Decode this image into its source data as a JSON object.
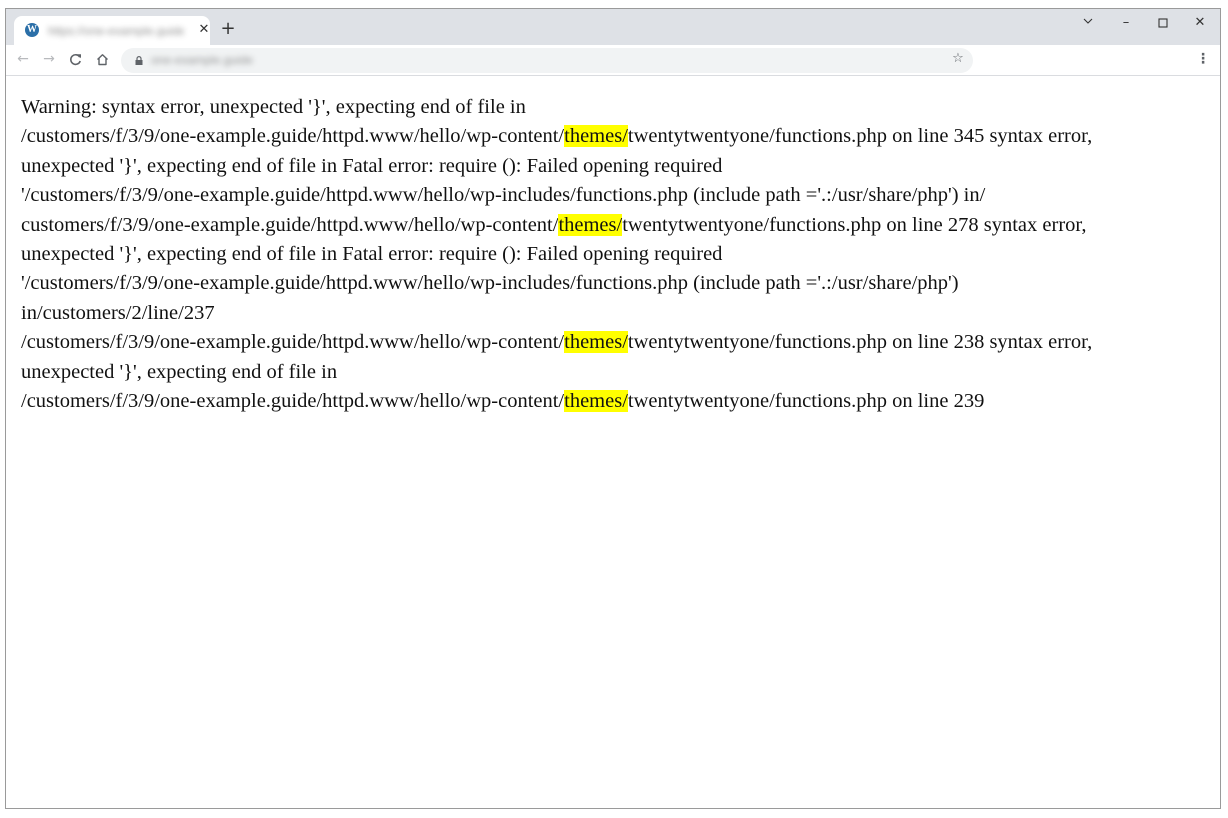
{
  "browser": {
    "tab": {
      "favicon": "wordpress-icon",
      "favicon_glyph": "W",
      "title": "https://one-example.guide",
      "close_glyph": "✕"
    },
    "new_tab_glyph": "+",
    "window_controls": {
      "dropdown_glyph": "⌄",
      "minimize_glyph": "–",
      "close_glyph": "✕"
    },
    "toolbar": {
      "back_glyph": "←",
      "forward_glyph": "→",
      "reload_glyph": "C",
      "url": "one-example.guide",
      "star_glyph": "☆",
      "menu_glyph": "⋮"
    }
  },
  "page": {
    "highlight_color": "#ffff00",
    "lines": [
      {
        "before": "Warning: syntax error, unexpected '}', expecting end of file in"
      },
      {
        "before": "/customers/f/3/9/one-example.guide/httpd.www/hello/wp-content/",
        "highlight": "themes/",
        "after": "twentytwentyone/functions.php on line 345 syntax error,"
      },
      {
        "before": "unexpected '}', expecting end of file in Fatal error: require (): Failed opening required"
      },
      {
        "before": "'/customers/f/3/9/one-example.guide/httpd.www/hello/wp-includes/functions.php (include path ='.:/usr/share/php') in/"
      },
      {
        "before": "customers/f/3/9/one-example.guide/httpd.www/hello/wp-content/",
        "highlight": "themes/",
        "after": "twentytwentyone/functions.php on line 278 syntax error,"
      },
      {
        "before": "unexpected '}', expecting end of file in Fatal error: require (): Failed opening required"
      },
      {
        "before": "'/customers/f/3/9/one-example.guide/httpd.www/hello/wp-includes/functions.php (include path ='.:/usr/share/php')"
      },
      {
        "before": "in/customers/2/line/237"
      },
      {
        "before": "/customers/f/3/9/one-example.guide/httpd.www/hello/wp-content/",
        "highlight": "themes/",
        "after": "twentytwentyone/functions.php on line 238 syntax error,"
      },
      {
        "before": "unexpected '}', expecting end of file in"
      },
      {
        "before": "/customers/f/3/9/one-example.guide/httpd.www/hello/wp-content/",
        "highlight": "themes/",
        "after": "twentytwentyone/functions.php on line 239"
      }
    ]
  }
}
